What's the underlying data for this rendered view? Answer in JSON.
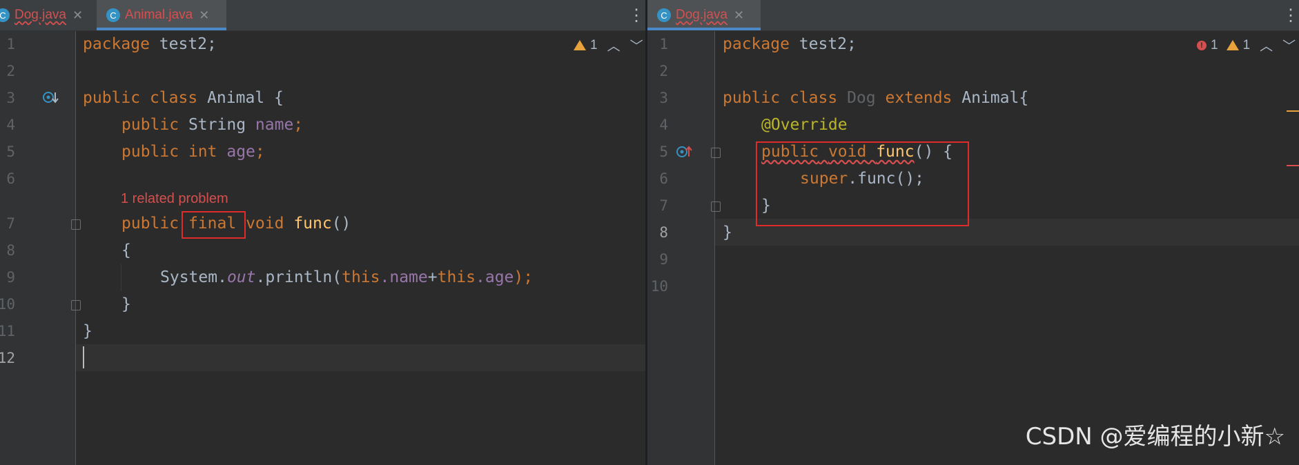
{
  "left": {
    "tabs": [
      {
        "label": "Dog.java",
        "icon": "C",
        "active": false
      },
      {
        "label": "Animal.java",
        "icon": "C",
        "active": true
      }
    ],
    "inspection": {
      "warnings": "1"
    },
    "line_numbers": [
      "1",
      "2",
      "3",
      "4",
      "5",
      "6",
      "7",
      "8",
      "9",
      "10",
      "11",
      "12"
    ],
    "code": {
      "l1": {
        "kw": "package",
        "rest": " test2;"
      },
      "l3": {
        "kw1": "public",
        "kw2": "class",
        "name": "Animal",
        "brace": "{"
      },
      "l4": {
        "kw": "public",
        "type": "String",
        "field": "name",
        "semi": ";"
      },
      "l5": {
        "kw": "public",
        "type": "int",
        "field": "age",
        "semi": ";"
      },
      "hint": "1 related problem",
      "l7": {
        "kw1": "public",
        "kw2": "final",
        "kw3": "void",
        "method": "func",
        "parens": "()"
      },
      "l8": {
        "brace": "{"
      },
      "l9": {
        "obj": "System.",
        "static": "out",
        "call": ".println(",
        "this1": "this",
        "f1": ".name",
        "plus": "+",
        "this2": "this",
        "f2": ".age",
        "end": ");"
      },
      "l10": {
        "brace": "}"
      },
      "l11": {
        "brace": "}"
      }
    }
  },
  "right": {
    "tabs": [
      {
        "label": "Dog.java",
        "icon": "C",
        "active": true
      }
    ],
    "inspection": {
      "errors": "1",
      "warnings": "1"
    },
    "line_numbers": [
      "1",
      "2",
      "3",
      "4",
      "5",
      "6",
      "7",
      "8",
      "9",
      "10"
    ],
    "code": {
      "l1": {
        "kw": "package",
        "rest": " test2;"
      },
      "l3": {
        "kw1": "public",
        "kw2": "class",
        "name": "Dog",
        "kw3": "extends",
        "parent": "Animal",
        "brace": "{"
      },
      "l4": {
        "ann": "@Override"
      },
      "l5": {
        "kw1": "public",
        "kw2": "void",
        "method": "func",
        "rest": "() {"
      },
      "l6": {
        "kw": "super",
        "rest": ".func();"
      },
      "l7": {
        "brace": "}"
      },
      "l8": {
        "brace": "}"
      }
    }
  },
  "watermark": "CSDN @爱编程的小新☆",
  "colors": {
    "keyword": "#cc7832",
    "text": "#a9b7c6",
    "field": "#9876aa",
    "method": "#ffc66d",
    "annotation": "#bbb529",
    "error": "#d64f4f",
    "highlight_box": "#e02b2b"
  }
}
